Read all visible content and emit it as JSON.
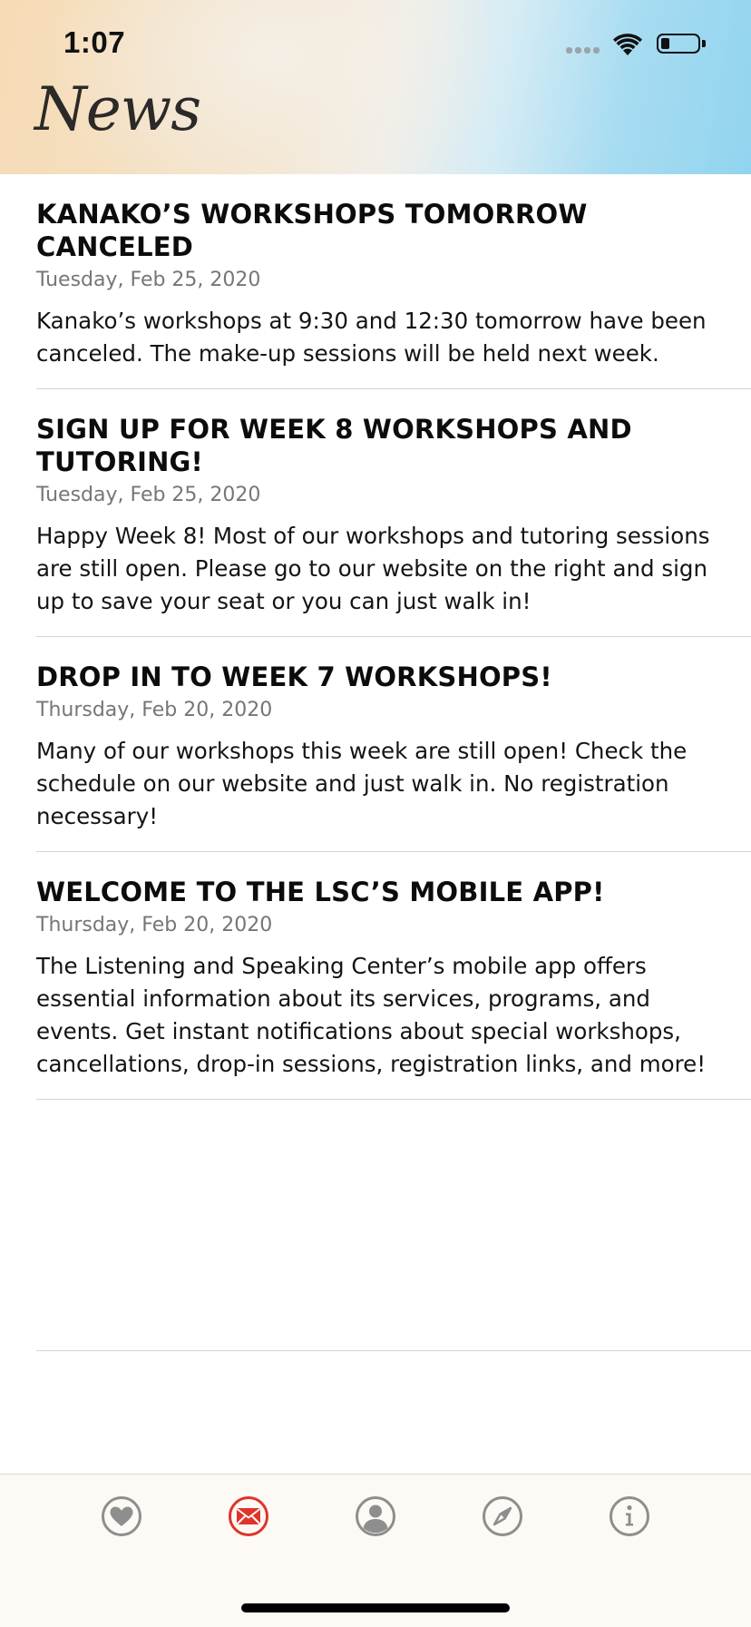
{
  "status_bar": {
    "time": "1:07"
  },
  "header": {
    "title": "News"
  },
  "news": [
    {
      "title": "KANAKO’S WORKSHOPS TOMORROW CANCELED",
      "date": "Tuesday, Feb 25, 2020",
      "body": "Kanako’s workshops at 9:30 and 12:30 tomorrow have been canceled. The make-up sessions will be held next week."
    },
    {
      "title": "SIGN UP FOR WEEK 8 WORKSHOPS AND TUTORING!",
      "date": "Tuesday, Feb 25, 2020",
      "body": "Happy Week 8! Most of our workshops and tutoring sessions are still open. Please go to our website on the right and sign up to save your seat or you can just walk in!"
    },
    {
      "title": "DROP IN TO WEEK 7 WORKSHOPS!",
      "date": "Thursday, Feb 20, 2020",
      "body": "Many of our workshops this week are still open! Check the schedule on our website and just walk in. No registration necessary!"
    },
    {
      "title": "WELCOME TO THE LSC’S MOBILE APP!",
      "date": "Thursday, Feb 20, 2020",
      "body": "The Listening and Speaking Center’s mobile app offers essential information about its services, programs, and events. Get instant notifications about special workshops, cancellations, drop-in sessions, registration links, and more!"
    }
  ],
  "tab_bar": {
    "tabs": [
      {
        "icon": "heart-icon",
        "active": false
      },
      {
        "icon": "mail-icon",
        "active": true
      },
      {
        "icon": "person-icon",
        "active": false
      },
      {
        "icon": "compass-icon",
        "active": false
      },
      {
        "icon": "info-icon",
        "active": false
      }
    ],
    "active_color": "#e0342a",
    "inactive_color": "#8e8e8e"
  }
}
